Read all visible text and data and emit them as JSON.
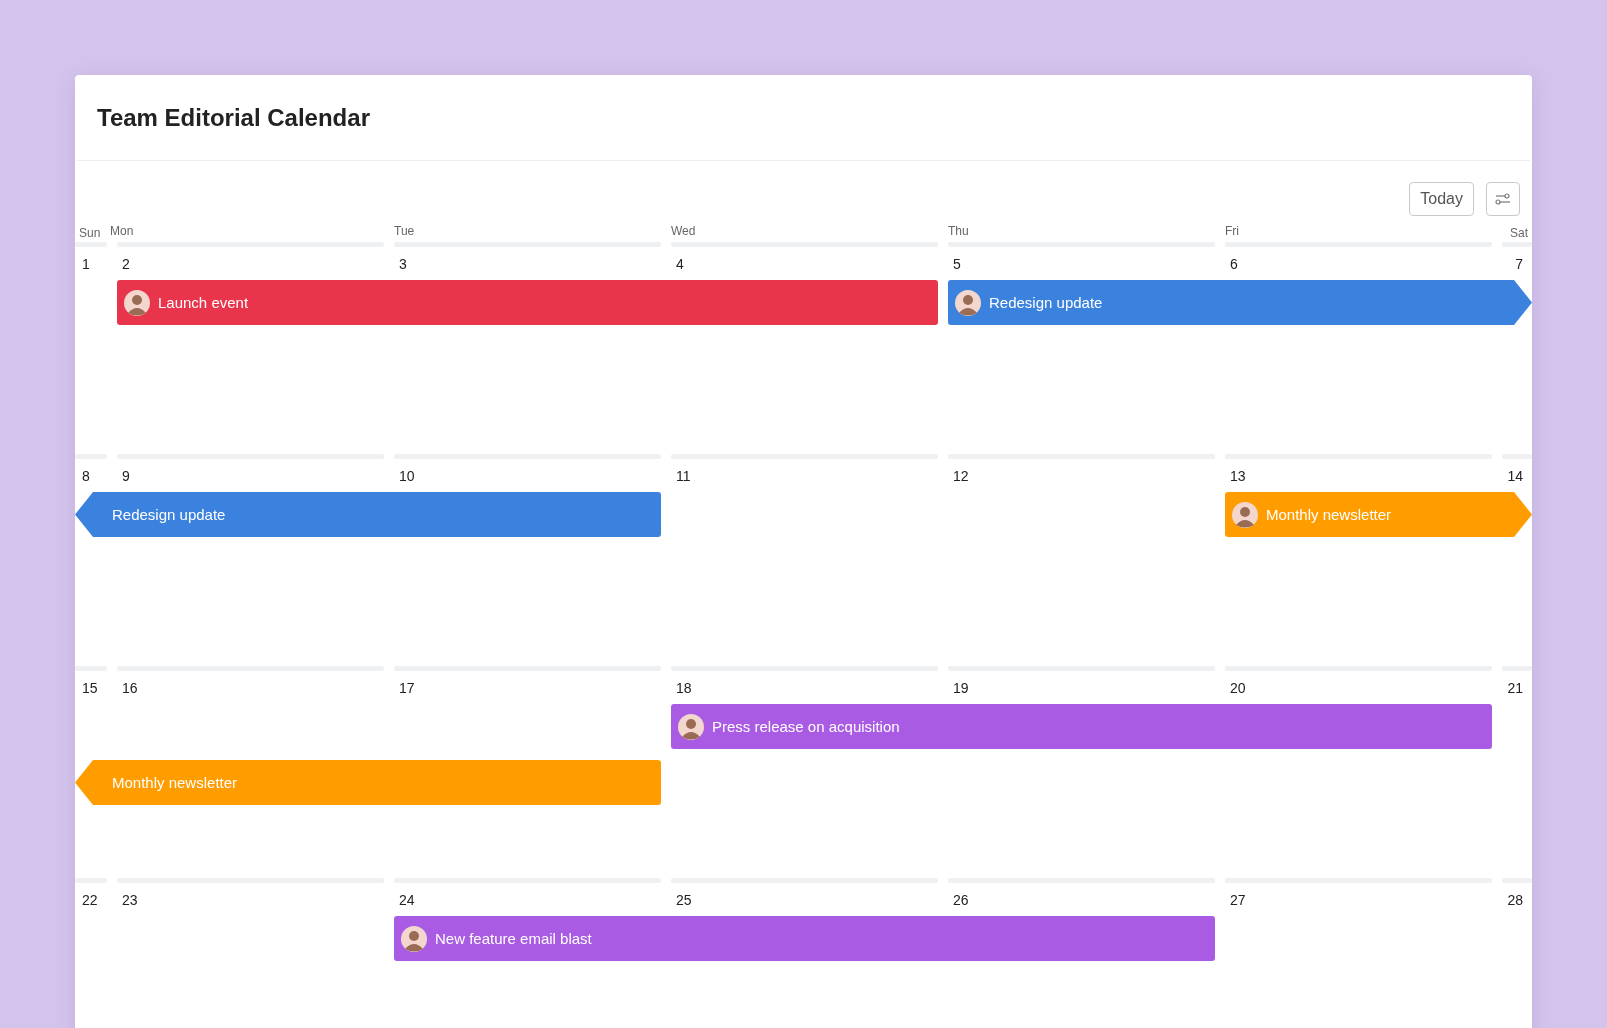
{
  "title": "Team Editorial Calendar",
  "toolbar": {
    "today_button": "Today"
  },
  "weekdays": [
    "Sun",
    "Mon",
    "Tue",
    "Wed",
    "Thu",
    "Fri",
    "Sat"
  ],
  "weeks": [
    {
      "days": [
        "1",
        "2",
        "3",
        "4",
        "5",
        "6",
        "7"
      ],
      "events": [
        {
          "title": "Launch event",
          "color": "#e8354b",
          "avatar": true,
          "continues_before": false,
          "continues_after": false
        },
        {
          "title": "Redesign update",
          "color": "#3b82de",
          "avatar": true,
          "continues_before": false,
          "continues_after": true
        }
      ]
    },
    {
      "days": [
        "8",
        "9",
        "10",
        "11",
        "12",
        "13",
        "14"
      ],
      "events": [
        {
          "title": "Redesign update",
          "color": "#3b82de",
          "avatar": false,
          "continues_before": true,
          "continues_after": false
        },
        {
          "title": "Monthly newsletter",
          "color": "#ff9d00",
          "avatar": true,
          "continues_before": false,
          "continues_after": true
        }
      ]
    },
    {
      "days": [
        "15",
        "16",
        "17",
        "18",
        "19",
        "20",
        "21"
      ],
      "events": [
        {
          "title": "Press release on acquisition",
          "color": "#a95ce3",
          "avatar": true,
          "continues_before": false,
          "continues_after": false
        },
        {
          "title": "Monthly newsletter",
          "color": "#ff9d00",
          "avatar": false,
          "continues_before": true,
          "continues_after": false
        }
      ]
    },
    {
      "days": [
        "22",
        "23",
        "24",
        "25",
        "26",
        "27",
        "28"
      ],
      "events": [
        {
          "title": "New feature email blast",
          "color": "#a95ce3",
          "avatar": true,
          "continues_before": false,
          "continues_after": false
        }
      ]
    }
  ]
}
